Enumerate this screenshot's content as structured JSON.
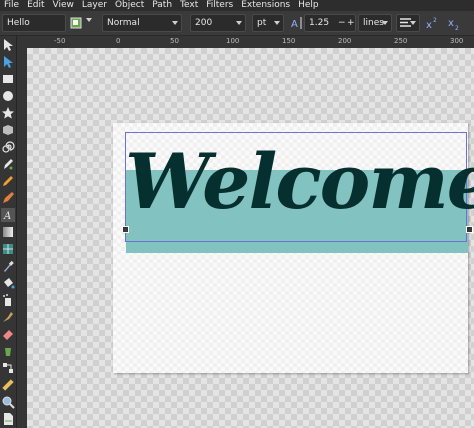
{
  "menu": [
    "File",
    "Edit",
    "View",
    "Layer",
    "Object",
    "Path",
    "Text",
    "Filters",
    "Extensions",
    "Help"
  ],
  "toolbar": {
    "font_family": "Hello",
    "font_style": "Normal",
    "font_size": "200",
    "unit": "pt",
    "line_height": "1.25",
    "spacing_mode": "lines",
    "minus_label": "−",
    "plus_label": "+"
  },
  "ruler": {
    "top_labels": [
      "-50",
      "0",
      "50",
      "100",
      "150",
      "200",
      "250",
      "300"
    ]
  },
  "canvas": {
    "text": "Welcome",
    "text_color": "#06302f",
    "band_color": "#7bbfbd"
  },
  "icons": [
    "selector-icon",
    "node-icon",
    "rect-icon",
    "circle-icon",
    "star-icon",
    "box3d-icon",
    "spiral-icon",
    "pen-icon",
    "pencil-icon",
    "calligraphy-icon",
    "text-icon",
    "gradient-icon",
    "mesh-icon",
    "dropper-icon",
    "paint-bucket-icon",
    "spray-icon",
    "eraser-icon",
    "connector-icon",
    "measure-icon",
    "zoom-icon",
    "page-icon"
  ]
}
